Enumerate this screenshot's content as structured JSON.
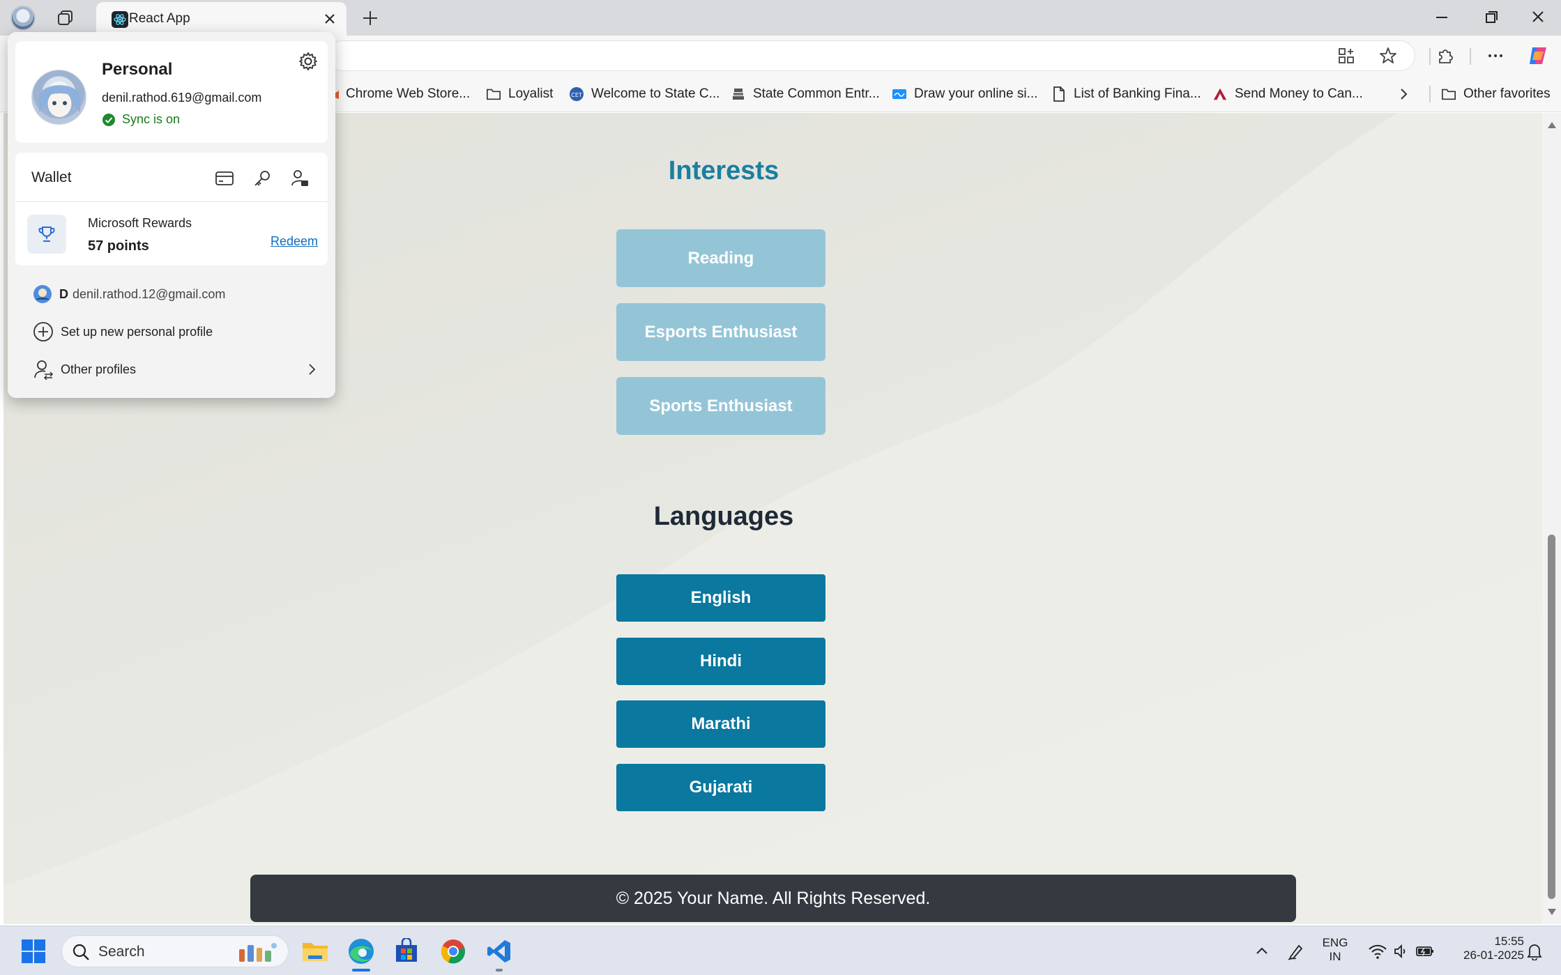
{
  "browser": {
    "tab_title": "React App",
    "favorites": [
      {
        "label": "Chrome Web Store...",
        "icon": "chrome-store-icon"
      },
      {
        "label": "Loyalist",
        "icon": "folder-icon"
      },
      {
        "label": "Welcome to State C...",
        "icon": "cet-icon"
      },
      {
        "label": "State Common Entr...",
        "icon": "emblem-icon"
      },
      {
        "label": "Draw your online si...",
        "icon": "signature-icon"
      },
      {
        "label": "List of Banking Fina...",
        "icon": "document-icon"
      },
      {
        "label": "Send Money to Can...",
        "icon": "bank-logo-icon"
      }
    ],
    "other_favorites": "Other favorites"
  },
  "profile_popup": {
    "name": "Personal",
    "email": "denil.rathod.619@gmail.com",
    "sync_status": "Sync is on",
    "wallet_label": "Wallet",
    "rewards_label": "Microsoft Rewards",
    "rewards_points": "57 points",
    "redeem_label": "Redeem",
    "other_account_initial": "D",
    "other_account_email": "denil.rathod.12@gmail.com",
    "new_profile_label": "Set up new personal profile",
    "other_profiles_label": "Other profiles"
  },
  "page": {
    "interests_title": "Interests",
    "interests": [
      "Reading",
      "Esports Enthusiast",
      "Sports Enthusiast"
    ],
    "languages_title": "Languages",
    "languages": [
      "English",
      "Hindi",
      "Marathi",
      "Gujarati"
    ],
    "footer": "© 2025 Your Name. All Rights Reserved."
  },
  "taskbar": {
    "search_label": "Search",
    "lang_top": "ENG",
    "lang_bottom": "IN",
    "time": "15:55",
    "date": "26-01-2025"
  },
  "colors": {
    "interests_title": "#1b7fa0",
    "languages_title": "#1e2a36",
    "interest_chip": "#94c5d7",
    "language_chip": "#0a789f",
    "footer_bg": "#343a40"
  }
}
